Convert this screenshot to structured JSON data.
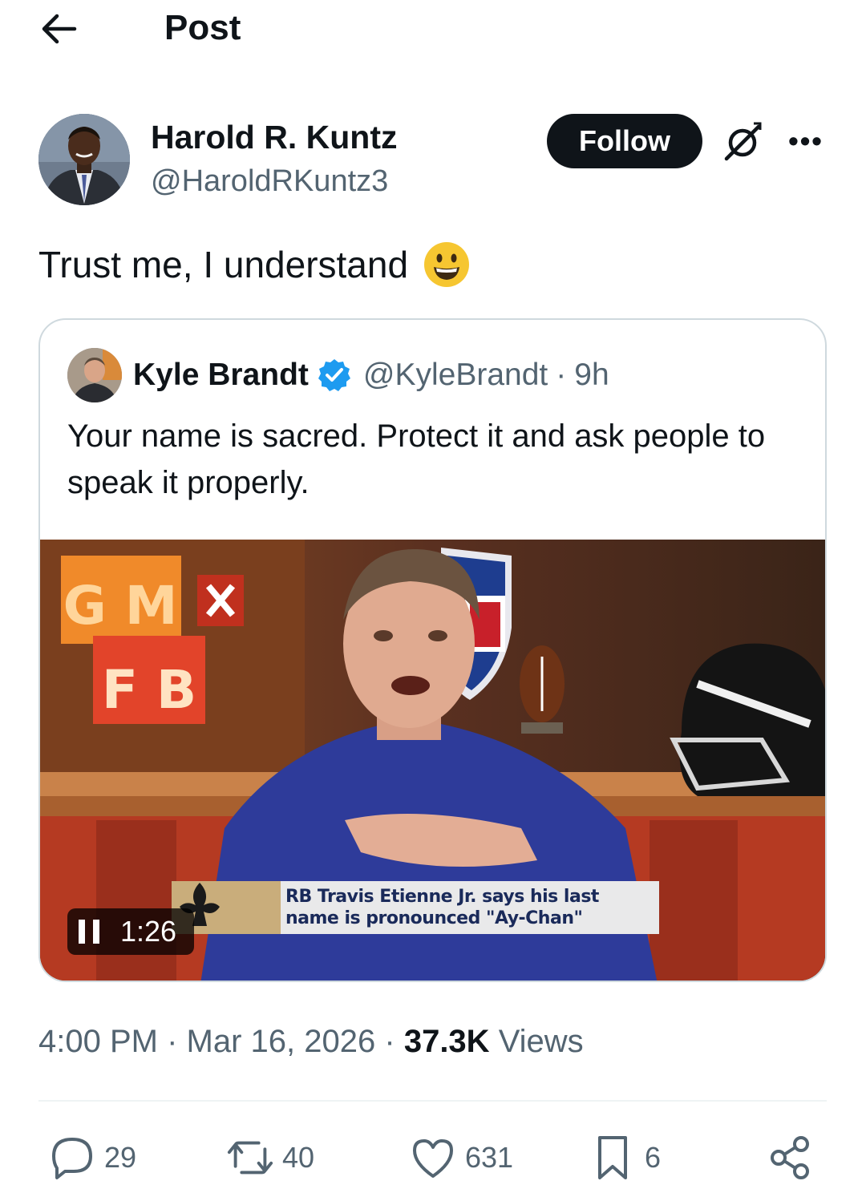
{
  "header": {
    "title": "Post",
    "back_icon": "arrow-left-icon"
  },
  "author": {
    "name": "Harold R. Kuntz",
    "handle": "@HaroldRKuntz3",
    "follow_label": "Follow",
    "more_label": "•••"
  },
  "post": {
    "text": "Trust me, I understand",
    "emoji": "grinning-face"
  },
  "quote": {
    "name": "Kyle Brandt",
    "verified": true,
    "handle": "@KyleBrandt",
    "separator": "·",
    "time": "9h",
    "text": "Your name is sacred. Protect it and ask people to speak it properly.",
    "video": {
      "duration": "1:26",
      "state": "playing",
      "chyron": "RB Travis Etienne Jr. says his last name is pronounced \"Ay-Chan\"",
      "set_signs": {
        "top": "G M",
        "bottom": "F B"
      }
    }
  },
  "meta": {
    "time": "4:00 PM",
    "date": "Mar 16, 2026",
    "views_count": "37.3K",
    "views_label": "Views",
    "separator": "·"
  },
  "actions": {
    "replies": "29",
    "reposts": "40",
    "likes": "631",
    "bookmarks": "6"
  },
  "colors": {
    "text_primary": "#0f1419",
    "text_secondary": "#536471",
    "follow_bg": "#0f1419",
    "border": "#cfd9de",
    "verified_blue": "#1d9bf0"
  }
}
